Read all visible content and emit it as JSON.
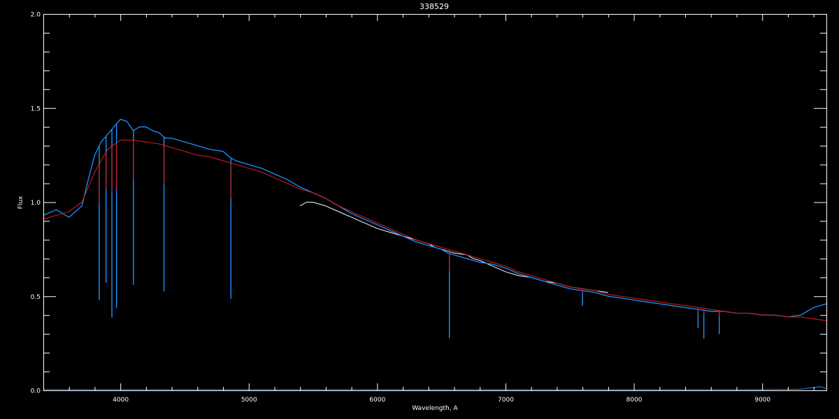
{
  "chart_data": {
    "type": "line",
    "title": "338529",
    "xlabel": "Wavelength, A",
    "ylabel": "Flux",
    "xlim": [
      3400,
      9500
    ],
    "ylim": [
      0.0,
      2.0
    ],
    "x_ticks": [
      4000,
      5000,
      6000,
      7000,
      8000,
      9000
    ],
    "x_tick_labels": [
      "4000",
      "5000",
      "6000",
      "7000",
      "8000",
      "9000"
    ],
    "y_ticks": [
      0.0,
      0.5,
      1.0,
      1.5,
      2.0
    ],
    "y_tick_labels": [
      "0.0",
      "0.5",
      "1.0",
      "1.5",
      "2.0"
    ],
    "grid": false,
    "colors": {
      "background": "#000000",
      "axes": "#ffffff",
      "observed": "#1e8fff",
      "reference": "#ffffff",
      "model": "#d01818"
    },
    "series": [
      {
        "color": "#ffffff",
        "x": [
          5400,
          5450,
          5500,
          5600,
          5700,
          5800,
          5900,
          6000,
          6100,
          6200,
          6300,
          6400,
          6450,
          6500,
          6600,
          6700,
          6750,
          6800,
          6900,
          7000,
          7100,
          7200,
          7300,
          7400,
          7500,
          7600,
          7700,
          7800
        ],
        "y": [
          0.98,
          1.0,
          1.0,
          0.98,
          0.95,
          0.92,
          0.89,
          0.86,
          0.84,
          0.82,
          0.8,
          0.78,
          0.76,
          0.75,
          0.73,
          0.72,
          0.7,
          0.69,
          0.66,
          0.63,
          0.61,
          0.6,
          0.58,
          0.57,
          0.55,
          0.54,
          0.53,
          0.52
        ]
      },
      {
        "color": "#1e8fff",
        "x": [
          3400,
          3500,
          3600,
          3700,
          3750,
          3800,
          3850,
          3900,
          3950,
          4000,
          4050,
          4100,
          4150,
          4200,
          4250,
          4300,
          4350,
          4400,
          4500,
          4600,
          4700,
          4800,
          4850,
          4900,
          5000,
          5100,
          5200,
          5300,
          5400,
          5500,
          5600,
          5700,
          5800,
          5900,
          6000,
          6100,
          6200,
          6300,
          6400,
          6500,
          6550,
          6600,
          6700,
          6800,
          6900,
          7000,
          7100,
          7200,
          7300,
          7400,
          7500,
          7600,
          7700,
          7800,
          7900,
          8000,
          8100,
          8200,
          8300,
          8400,
          8500,
          8600,
          8700,
          8800,
          8900,
          9000,
          9100,
          9200,
          9300,
          9400,
          9500
        ],
        "y": [
          0.93,
          0.96,
          0.92,
          0.98,
          1.12,
          1.25,
          1.32,
          1.36,
          1.4,
          1.44,
          1.43,
          1.38,
          1.4,
          1.4,
          1.38,
          1.37,
          1.34,
          1.34,
          1.32,
          1.3,
          1.28,
          1.27,
          1.24,
          1.22,
          1.2,
          1.18,
          1.15,
          1.12,
          1.08,
          1.05,
          1.02,
          0.98,
          0.94,
          0.91,
          0.88,
          0.85,
          0.82,
          0.79,
          0.77,
          0.75,
          0.73,
          0.72,
          0.7,
          0.68,
          0.67,
          0.65,
          0.62,
          0.6,
          0.58,
          0.56,
          0.54,
          0.53,
          0.52,
          0.5,
          0.49,
          0.48,
          0.47,
          0.46,
          0.45,
          0.44,
          0.43,
          0.42,
          0.42,
          0.41,
          0.41,
          0.4,
          0.4,
          0.39,
          0.4,
          0.44,
          0.46
        ]
      },
      {
        "color": "#1e8fff",
        "x": [
          3400,
          4000,
          5000,
          6000,
          7000,
          8000,
          9000,
          9300,
          9450,
          9500
        ],
        "y": [
          0.005,
          0.004,
          0.004,
          0.004,
          0.004,
          0.004,
          0.004,
          0.006,
          0.02,
          0.01
        ]
      },
      {
        "color": "#d01818",
        "x": [
          3400,
          3500,
          3600,
          3700,
          3800,
          3900,
          4000,
          4100,
          4200,
          4300,
          4400,
          4500,
          4600,
          4700,
          4800,
          4900,
          5000,
          5100,
          5200,
          5300,
          5400,
          5500,
          5600,
          5700,
          5800,
          5900,
          6000,
          6100,
          6200,
          6300,
          6400,
          6500,
          6600,
          6700,
          6800,
          6900,
          7000,
          7100,
          7200,
          7300,
          7400,
          7500,
          7600,
          7700,
          7800,
          7900,
          8000,
          8100,
          8200,
          8300,
          8400,
          8500,
          8600,
          8700,
          8800,
          8900,
          9000,
          9100,
          9200,
          9300,
          9400,
          9500
        ],
        "y": [
          0.91,
          0.93,
          0.95,
          1.0,
          1.16,
          1.28,
          1.33,
          1.33,
          1.32,
          1.31,
          1.29,
          1.27,
          1.25,
          1.24,
          1.22,
          1.2,
          1.18,
          1.16,
          1.13,
          1.1,
          1.07,
          1.05,
          1.02,
          0.98,
          0.95,
          0.92,
          0.89,
          0.86,
          0.83,
          0.8,
          0.78,
          0.76,
          0.74,
          0.72,
          0.7,
          0.68,
          0.66,
          0.63,
          0.61,
          0.59,
          0.57,
          0.55,
          0.54,
          0.53,
          0.51,
          0.5,
          0.49,
          0.48,
          0.47,
          0.46,
          0.45,
          0.44,
          0.43,
          0.42,
          0.41,
          0.41,
          0.4,
          0.4,
          0.39,
          0.39,
          0.38,
          0.37
        ]
      }
    ],
    "absorption_lines": [
      {
        "x": 3835,
        "depth": 0.82
      },
      {
        "x": 3889,
        "depth": 0.78
      },
      {
        "x": 3934,
        "depth": 1.0
      },
      {
        "x": 3970,
        "depth": 0.98
      },
      {
        "x": 4102,
        "depth": 0.82
      },
      {
        "x": 4340,
        "depth": 0.82
      },
      {
        "x": 4861,
        "depth": 0.75
      },
      {
        "x": 6563,
        "depth": 0.45
      },
      {
        "x": 7600,
        "depth": 0.08
      },
      {
        "x": 8500,
        "depth": 0.1
      },
      {
        "x": 8545,
        "depth": 0.15
      },
      {
        "x": 8665,
        "depth": 0.12
      }
    ]
  }
}
